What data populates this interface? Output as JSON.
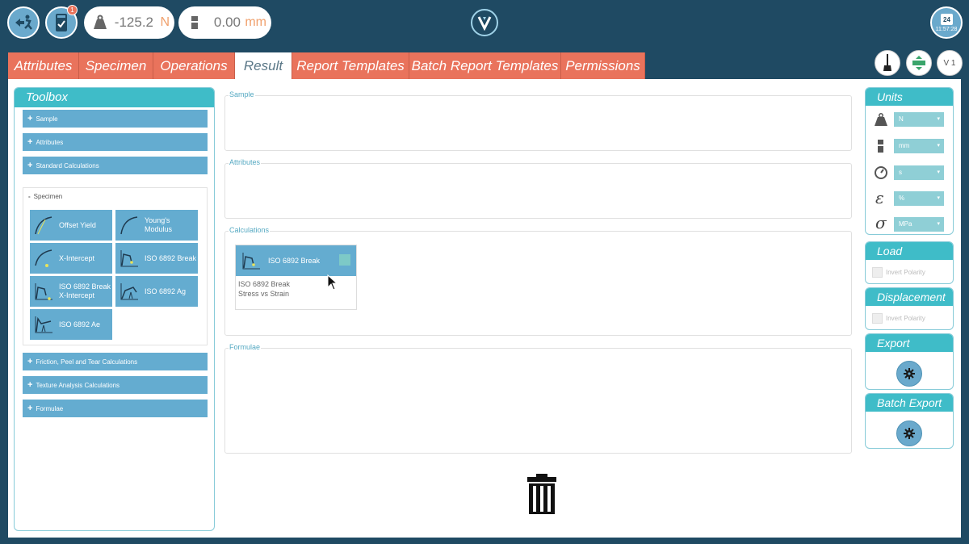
{
  "topbar": {
    "force_value": "-125.2",
    "force_unit": "N",
    "displacement_value": "0.00",
    "displacement_unit": "mm",
    "notification_count": "1",
    "calendar_day": "24",
    "time": "11:57:28"
  },
  "tabs": [
    {
      "label": "Attributes"
    },
    {
      "label": "Specimen"
    },
    {
      "label": "Operations"
    },
    {
      "label": "Result"
    },
    {
      "label": "Report Templates"
    },
    {
      "label": "Batch Report Templates"
    },
    {
      "label": "Permissions"
    }
  ],
  "top_right": {
    "version_label": "V 1"
  },
  "toolbox": {
    "title": "Toolbox",
    "sections": [
      {
        "label": "Sample"
      },
      {
        "label": "Attributes"
      },
      {
        "label": "Standard Calculations"
      },
      {
        "label": "Specimen"
      },
      {
        "label": "Friction, Peel and Tear Calculations"
      },
      {
        "label": "Texture Analysis Calculations"
      },
      {
        "label": "Formulae"
      }
    ],
    "specimen_tiles": [
      {
        "label": "Offset Yield"
      },
      {
        "label": "Young's Modulus"
      },
      {
        "label": "X-Intercept"
      },
      {
        "label": "ISO 6892 Break"
      },
      {
        "label": "ISO 6892 Break X-Intercept"
      },
      {
        "label": "ISO 6892 Ag"
      },
      {
        "label": "ISO 6892 Ae"
      }
    ]
  },
  "main": {
    "sample_label": "Sample",
    "attributes_label": "Attributes",
    "calculations_label": "Calculations",
    "formulae_label": "Formulae",
    "calc_card": {
      "title": "ISO 6892 Break",
      "desc_line1": "ISO 6892 Break",
      "desc_line2": "Stress vs Strain"
    }
  },
  "units": {
    "title": "Units",
    "force": "N",
    "displacement": "mm",
    "time": "s",
    "strain": "%",
    "stress": "MPa"
  },
  "load": {
    "title": "Load",
    "invert_label": "Invert Polarity"
  },
  "displacement": {
    "title": "Displacement",
    "invert_label": "Invert Polarity"
  },
  "export": {
    "title": "Export"
  },
  "batch_export": {
    "title": "Batch Export"
  },
  "colors": {
    "background": "#1f4a63",
    "tab_orange": "#e9735c",
    "panel_header": "#3fbcc8",
    "tile_blue": "#64acd0"
  }
}
